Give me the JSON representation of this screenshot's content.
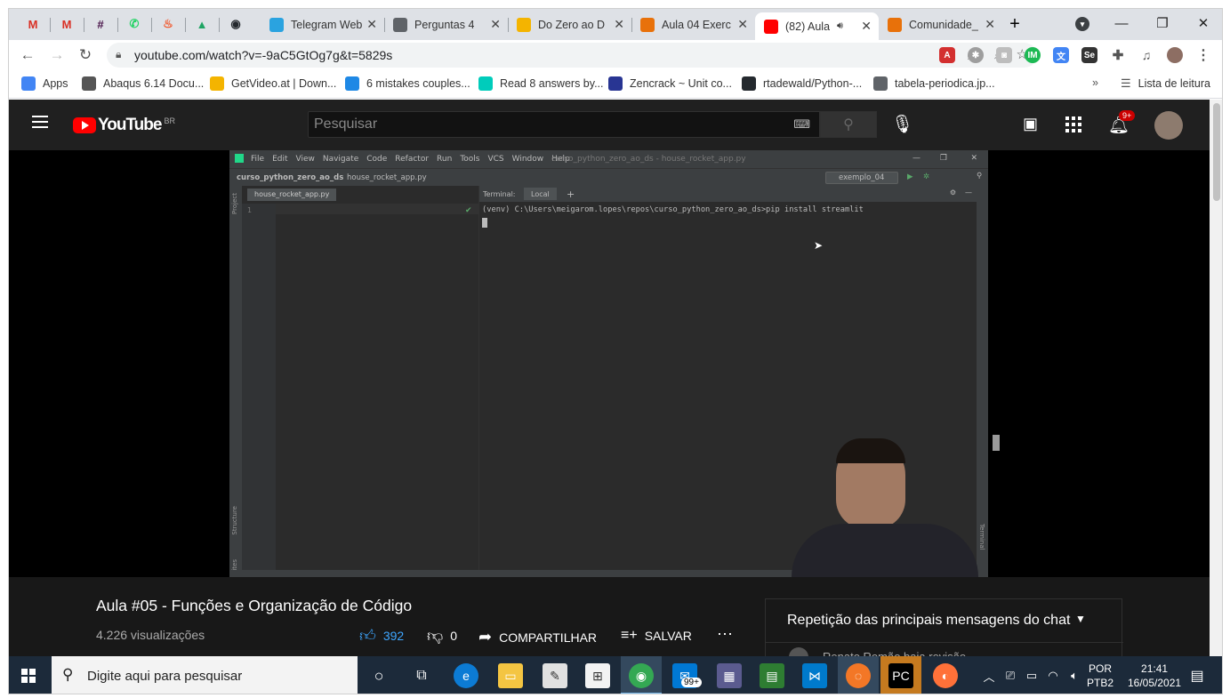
{
  "browser": {
    "pinned_tabs": [
      {
        "icon": "gmail-icon",
        "letter": "M",
        "color": "#d93025"
      },
      {
        "icon": "gmail-icon",
        "letter": "M",
        "color": "#d93025"
      },
      {
        "icon": "slack-icon",
        "letter": "#",
        "color": "#4a154b"
      },
      {
        "icon": "whatsapp-icon",
        "letter": "✆",
        "color": "#25d366"
      },
      {
        "icon": "fire-icon",
        "letter": "♨",
        "color": "#f25022"
      },
      {
        "icon": "drive-icon",
        "letter": "▲",
        "color": "#1fa463"
      },
      {
        "icon": "github-icon",
        "letter": "◉",
        "color": "#24292e"
      }
    ],
    "tabs": [
      {
        "title": "Telegram Web",
        "icon": "telegram-icon",
        "color": "#2aa3e0"
      },
      {
        "title": "Perguntas 4",
        "icon": "globe-icon",
        "color": "#5f6368"
      },
      {
        "title": "Do Zero ao D",
        "icon": "slides-icon",
        "color": "#f4b400"
      },
      {
        "title": "Aula 04 Exerc",
        "icon": "book-icon",
        "color": "#e8710a"
      },
      {
        "title": "(82) Aula",
        "icon": "youtube-icon",
        "color": "#ff0000",
        "active": true
      },
      {
        "title": "Comunidade_",
        "icon": "loading-icon",
        "color": "#e8710a"
      }
    ],
    "new_tab": "+",
    "url": "youtube.com/watch?v=-9aC5GtOg7g&t=5829s",
    "bookmarks": [
      {
        "label": "Apps",
        "icon": "apps-grid-icon",
        "color": "#4285f4"
      },
      {
        "label": "Abaqus 6.14 Docu...",
        "icon": "abaqus-icon",
        "color": "#555"
      },
      {
        "label": "GetVideo.at | Down...",
        "icon": "getvideo-icon",
        "color": "#f4b400"
      },
      {
        "label": "6 mistakes couples...",
        "icon": "bird-icon",
        "color": "#1e88e5"
      },
      {
        "label": "Read 8 answers by...",
        "icon": "researchgate-icon",
        "color": "#00ccbb"
      },
      {
        "label": "Zencrack ~ Unit co...",
        "icon": "zencrack-icon",
        "color": "#283593"
      },
      {
        "label": "rtadewald/Python-...",
        "icon": "github-icon",
        "color": "#24292e"
      },
      {
        "label": "tabela-periodica.jp...",
        "icon": "globe-icon",
        "color": "#5f6368"
      }
    ],
    "reading_list": "Lista de leitura"
  },
  "youtube": {
    "logo_text": "YouTube",
    "region": "BR",
    "search_placeholder": "Pesquisar",
    "notifications": "9+",
    "video_title": "Aula #05 - Funções e Organização de Código",
    "views": "4.226 visualizações",
    "likes": "392",
    "dislikes": "0",
    "share": "COMPARTILHAR",
    "save": "SALVAR",
    "chat_title": "Repetição das principais mensagens do chat",
    "chat_preview": "Renato Romão baia revisão"
  },
  "ide": {
    "menu": [
      "File",
      "Edit",
      "View",
      "Navigate",
      "Code",
      "Refactor",
      "Run",
      "Tools",
      "VCS",
      "Window",
      "Help"
    ],
    "window_title": "curso_python_zero_ao_ds - house_rocket_app.py",
    "project": "curso_python_zero_ao_ds",
    "file": "house_rocket_app.py",
    "run_config": "exemplo_04",
    "editor_tab": "house_rocket_app.py",
    "line_number": "1",
    "terminal_label": "Terminal:",
    "terminal_tab": "Local",
    "command": "(venv) C:\\Users\\meigarom.lopes\\repos\\curso_python_zero_ao_ds>pip install streamlit",
    "side_project": "Project",
    "side_structure": "Structure",
    "side_favorites": "Favorites",
    "side_terminal": "Terminal"
  },
  "taskbar": {
    "search_placeholder": "Digite aqui para pesquisar",
    "mail_badge": "99+",
    "lang": "POR",
    "layout": "PTB2",
    "time": "21:41",
    "date": "16/05/2021"
  }
}
